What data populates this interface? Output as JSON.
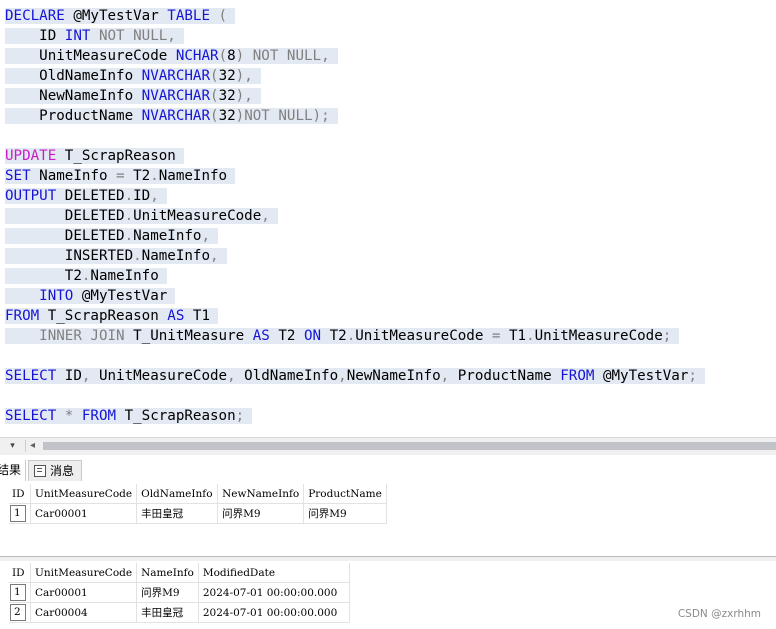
{
  "editor": {
    "lines": [
      [
        [
          "k",
          "DECLARE"
        ],
        [
          "t",
          " @MyTestVar "
        ],
        [
          "k",
          "TABLE"
        ],
        [
          "g",
          " ("
        ]
      ],
      [
        [
          "t",
          "    ID "
        ],
        [
          "k",
          "INT"
        ],
        [
          "g",
          " NOT NULL,"
        ]
      ],
      [
        [
          "t",
          "    UnitMeasureCode "
        ],
        [
          "k",
          "NCHAR"
        ],
        [
          "g",
          "("
        ],
        [
          "t",
          "8"
        ],
        [
          "g",
          ")"
        ],
        [
          "g",
          " NOT NULL,"
        ]
      ],
      [
        [
          "t",
          "    OldNameInfo "
        ],
        [
          "k",
          "NVARCHAR"
        ],
        [
          "g",
          "("
        ],
        [
          "t",
          "32"
        ],
        [
          "g",
          "),"
        ]
      ],
      [
        [
          "t",
          "    NewNameInfo "
        ],
        [
          "k",
          "NVARCHAR"
        ],
        [
          "g",
          "("
        ],
        [
          "t",
          "32"
        ],
        [
          "g",
          "),"
        ]
      ],
      [
        [
          "t",
          "    ProductName "
        ],
        [
          "k",
          "NVARCHAR"
        ],
        [
          "g",
          "("
        ],
        [
          "t",
          "32"
        ],
        [
          "g",
          ")NOT NULL);"
        ]
      ],
      [],
      [
        [
          "m",
          "UPDATE"
        ],
        [
          "t",
          " T_ScrapReason"
        ]
      ],
      [
        [
          "k",
          "SET"
        ],
        [
          "t",
          " NameInfo "
        ],
        [
          "g",
          "="
        ],
        [
          "t",
          " T2"
        ],
        [
          "g",
          "."
        ],
        [
          "t",
          "NameInfo"
        ]
      ],
      [
        [
          "k",
          "OUTPUT"
        ],
        [
          "t",
          " DELETED"
        ],
        [
          "g",
          "."
        ],
        [
          "t",
          "ID"
        ],
        [
          "g",
          ","
        ]
      ],
      [
        [
          "t",
          "       DELETED"
        ],
        [
          "g",
          "."
        ],
        [
          "t",
          "UnitMeasureCode"
        ],
        [
          "g",
          ","
        ]
      ],
      [
        [
          "t",
          "       DELETED"
        ],
        [
          "g",
          "."
        ],
        [
          "t",
          "NameInfo"
        ],
        [
          "g",
          ","
        ]
      ],
      [
        [
          "t",
          "       INSERTED"
        ],
        [
          "g",
          "."
        ],
        [
          "t",
          "NameInfo"
        ],
        [
          "g",
          ","
        ]
      ],
      [
        [
          "t",
          "       T2"
        ],
        [
          "g",
          "."
        ],
        [
          "t",
          "NameInfo"
        ]
      ],
      [
        [
          "k",
          "    INTO"
        ],
        [
          "t",
          " @MyTestVar"
        ]
      ],
      [
        [
          "k",
          "FROM"
        ],
        [
          "t",
          " T_ScrapReason "
        ],
        [
          "k",
          "AS"
        ],
        [
          "t",
          " T1"
        ]
      ],
      [
        [
          "g",
          "    INNER JOIN"
        ],
        [
          "t",
          " T_UnitMeasure "
        ],
        [
          "k",
          "AS"
        ],
        [
          "t",
          " T2 "
        ],
        [
          "k",
          "ON"
        ],
        [
          "t",
          " T2"
        ],
        [
          "g",
          "."
        ],
        [
          "t",
          "UnitMeasureCode "
        ],
        [
          "g",
          "="
        ],
        [
          "t",
          " T1"
        ],
        [
          "g",
          "."
        ],
        [
          "t",
          "UnitMeasureCode"
        ],
        [
          "g",
          ";"
        ]
      ],
      [],
      [
        [
          "k",
          "SELECT"
        ],
        [
          "t",
          " ID"
        ],
        [
          "g",
          ","
        ],
        [
          "t",
          " UnitMeasureCode"
        ],
        [
          "g",
          ","
        ],
        [
          "t",
          " OldNameInfo"
        ],
        [
          "g",
          ","
        ],
        [
          "t",
          "NewNameInfo"
        ],
        [
          "g",
          ","
        ],
        [
          "t",
          " ProductName "
        ],
        [
          "k",
          "FROM"
        ],
        [
          "t",
          " @MyTestVar"
        ],
        [
          "g",
          ";"
        ]
      ],
      [],
      [
        [
          "k",
          "SELECT"
        ],
        [
          "g",
          " *"
        ],
        [
          "k",
          " FROM"
        ],
        [
          "t",
          " T_ScrapReason"
        ],
        [
          "g",
          ";"
        ]
      ]
    ]
  },
  "scrollbar": {
    "zoom": "▾",
    "arrow": "◂"
  },
  "tabs": {
    "results_label": "结果",
    "messages_label": "消息"
  },
  "grid1": {
    "columns": [
      "ID",
      "UnitMeasureCode",
      "OldNameInfo",
      "NewNameInfo",
      "ProductName"
    ],
    "rows": [
      {
        "rownum": "1",
        "cells": [
          "Car00001",
          "丰田皇冠",
          "问界M9",
          "问界M9"
        ]
      }
    ]
  },
  "grid2": {
    "columns": [
      "ID",
      "UnitMeasureCode",
      "NameInfo",
      "ModifiedDate"
    ],
    "rows": [
      {
        "rownum": "1",
        "cells": [
          "Car00001",
          "问界M9",
          "2024-07-01 00:00:00.000"
        ]
      },
      {
        "rownum": "2",
        "cells": [
          "Car00004",
          "丰田皇冠",
          "2024-07-01 00:00:00.000"
        ]
      }
    ]
  },
  "watermark": "CSDN @zxrhhm"
}
